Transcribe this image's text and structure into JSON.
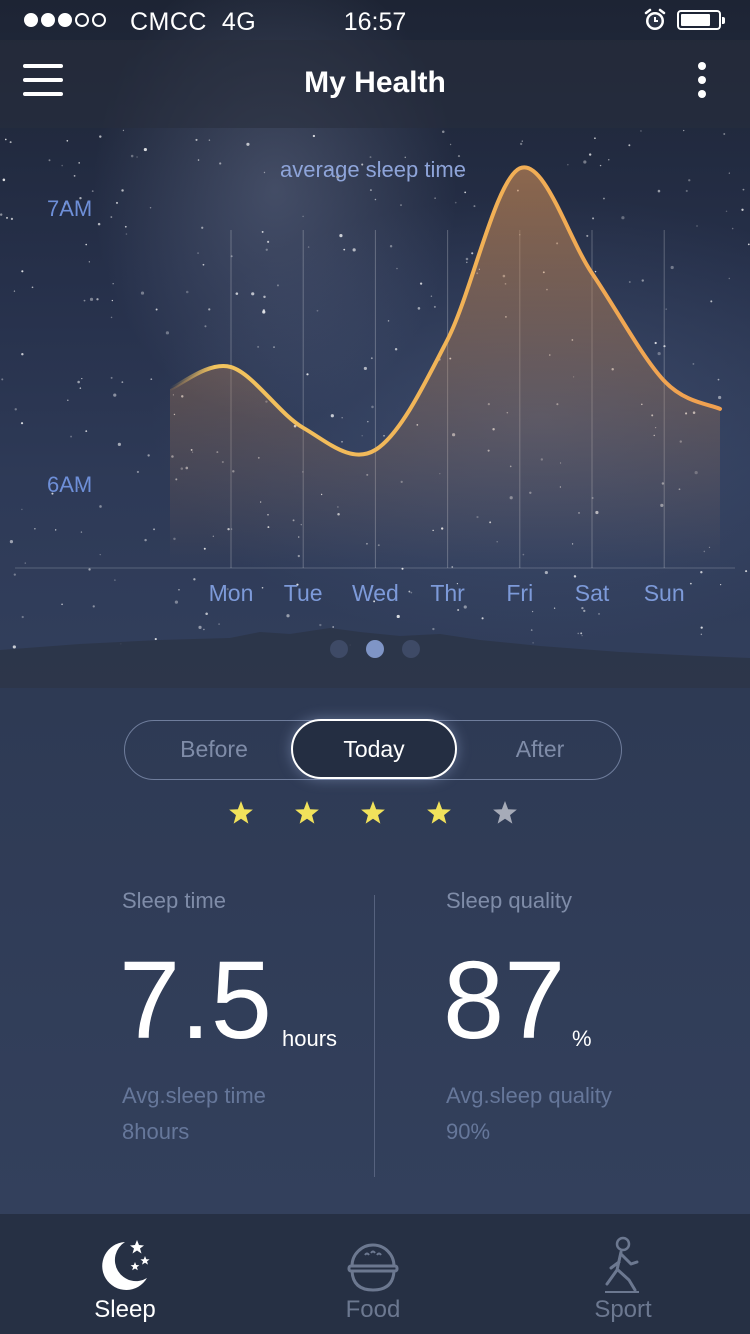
{
  "status_bar": {
    "signal": [
      true,
      true,
      true,
      false,
      false
    ],
    "carrier": "CMCC",
    "network": "4G",
    "time": "16:57",
    "battery_level": 0.8
  },
  "navbar": {
    "title": "My Health",
    "menu_icon": "hamburger-menu-icon",
    "more_icon": "vertical-dots-icon"
  },
  "chart_data": {
    "type": "area",
    "title": "average sleep time",
    "y_tick_labels": [
      "7AM",
      "6AM"
    ],
    "categories": [
      "Mon",
      "Tue",
      "Wed",
      "Thr",
      "Fri",
      "Sat",
      "Sun"
    ],
    "note_values": "wake-up time as hours after 6AM, estimated from curve",
    "values": [
      0.42,
      0.2,
      0.12,
      0.52,
      1.14,
      0.76,
      0.37
    ],
    "ylim": [
      0,
      1
    ],
    "grid": "vertical",
    "colors": {
      "line": "#f0a050",
      "fill": "#c98a55"
    }
  },
  "pager": {
    "count": 3,
    "active": 1
  },
  "segment": {
    "before_label": "Before",
    "today_label": "Today",
    "after_label": "After",
    "selected": "Today"
  },
  "rating": {
    "value": 4,
    "max": 5,
    "colors": {
      "on": "#f1e25b",
      "off": "#a6abb8"
    }
  },
  "sleep_time": {
    "label": "Sleep time",
    "value": "7.5",
    "unit": "hours",
    "avg_label": "Avg.sleep time",
    "avg_value": "8hours"
  },
  "sleep_quality": {
    "label": "Sleep quality",
    "value": "87",
    "unit": "%",
    "avg_label": "Avg.sleep quality",
    "avg_value": "90%"
  },
  "tabs": [
    {
      "label": "Sleep",
      "icon": "moon-stars-icon",
      "active": true
    },
    {
      "label": "Food",
      "icon": "rice-bowl-icon",
      "active": false
    },
    {
      "label": "Sport",
      "icon": "walking-person-icon",
      "active": false
    }
  ]
}
